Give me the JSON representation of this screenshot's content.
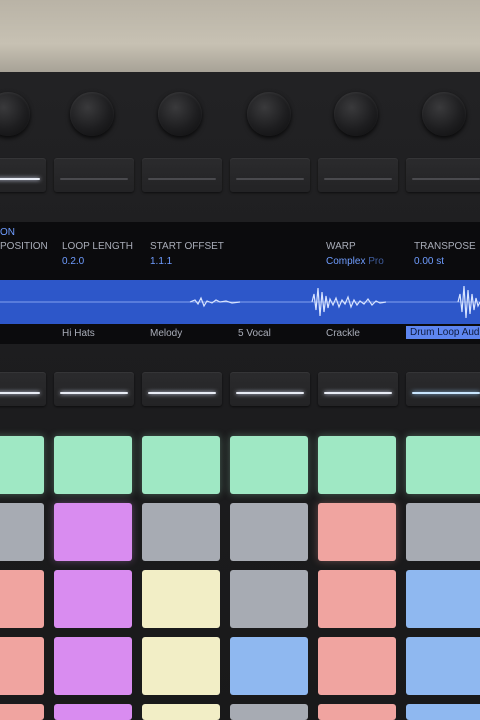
{
  "display": {
    "section": "ON",
    "params": [
      {
        "label": "POSITION",
        "value": ""
      },
      {
        "label": "LOOP LENGTH",
        "value": "0.2.0"
      },
      {
        "label": "START OFFSET",
        "value": "1.1.1"
      },
      {
        "label": "WARP",
        "value": "Complex",
        "hint": "Pro"
      },
      {
        "label": "TRANSPOSE",
        "value": "0.00 st"
      }
    ],
    "tracks": [
      "Hi Hats",
      "Melody",
      "5 Vocal",
      "Crackle",
      "Drum Loop Aud"
    ],
    "selected_track": "Drum Loop Aud"
  },
  "colors": {
    "waveform_bg": "#2d57c9",
    "value_text": "#6f9dff",
    "pad_mint": "#9fe8c4",
    "pad_magenta": "#d98cf0",
    "pad_gray": "#a7abb3",
    "pad_salmon": "#f0a4a0",
    "pad_cream": "#f2eec6",
    "pad_blue": "#8fb8f0"
  }
}
